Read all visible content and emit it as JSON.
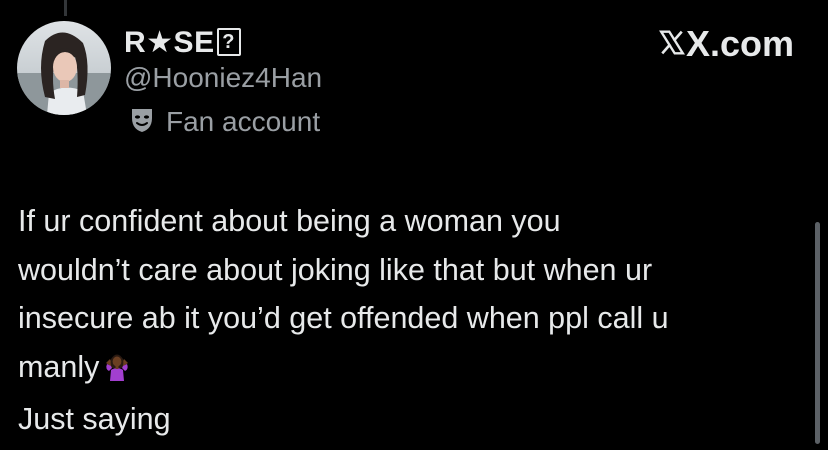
{
  "author": {
    "display_name": "R★SE",
    "name_glyph": "?",
    "handle": "@Hooniez4Han",
    "badge_label": "Fan account",
    "badge_icon": "mask-icon",
    "avatar_icon": "profile-photo"
  },
  "brand": {
    "label": "X.com",
    "icon": "x-logo"
  },
  "tweet": {
    "text": "If ur confident about being a woman you\nwouldn’t care about joking like that but when ur\ninsecure ab it you’d get offended when ppl call u\nmanly",
    "emoji": "woman-shrugging-emoji",
    "closing": "Just saying"
  },
  "colors": {
    "background": "#000000",
    "primary_text": "#e7e9ea",
    "secondary_text": "#9a9fa4",
    "thread_line": "#333639",
    "scrollbar": "#5c6166"
  }
}
